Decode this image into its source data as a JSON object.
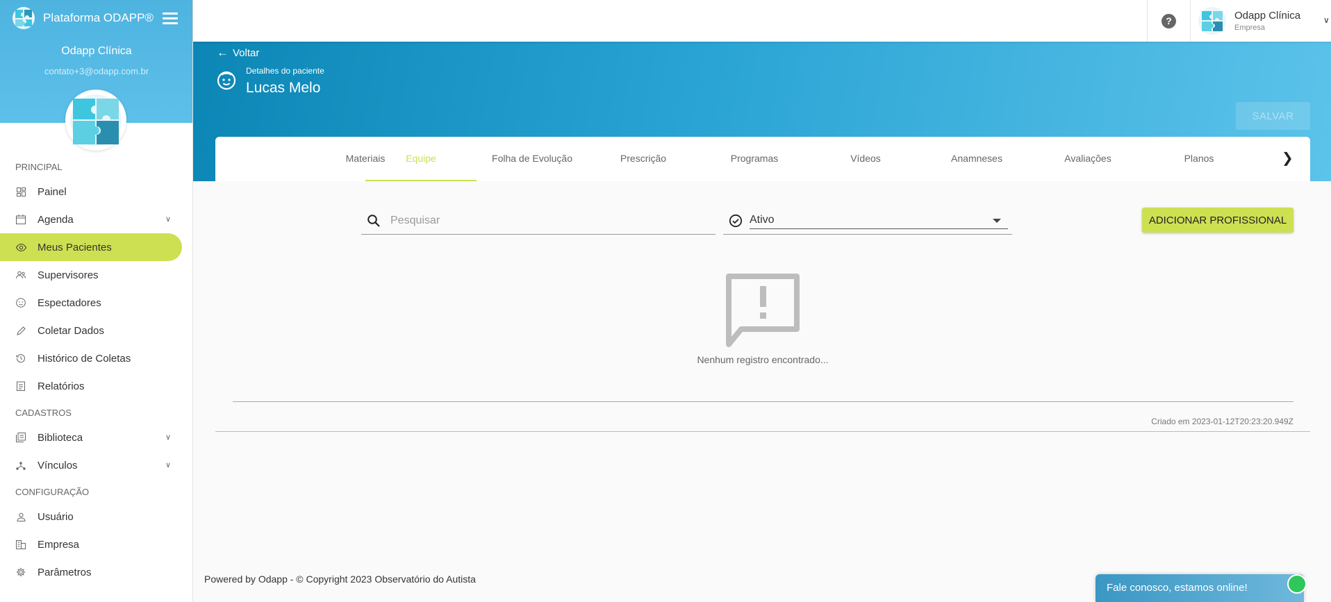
{
  "sidebar": {
    "brand": "Plataforma ODAPP®",
    "org_name": "Odapp Clínica",
    "email": "contato+3@odapp.com.br",
    "sections": {
      "principal": "PRINCIPAL",
      "cadastros": "CADASTROS",
      "configuracao": "CONFIGURAÇÃO"
    },
    "items": {
      "painel": "Painel",
      "agenda": "Agenda",
      "meus_pacientes": "Meus Pacientes",
      "supervisores": "Supervisores",
      "espectadores": "Espectadores",
      "coletar_dados": "Coletar Dados",
      "historico": "Histórico de Coletas",
      "relatorios": "Relatórios",
      "biblioteca": "Biblioteca",
      "vinculos": "Vínculos",
      "usuario": "Usuário",
      "empresa": "Empresa",
      "parametros": "Parâmetros"
    },
    "active_item": "Meus Pacientes"
  },
  "topbar": {
    "help_glyph": "?",
    "user_name": "Odapp Clínica",
    "user_role": "Empresa"
  },
  "header": {
    "back_label": "Voltar",
    "subtitle": "Detalhes do paciente",
    "patient_name": "Lucas Melo",
    "save_label": "SALVAR"
  },
  "tabs": {
    "items": [
      "Materiais",
      "Equipe",
      "Folha de Evolução",
      "Prescrição",
      "Programas",
      "Vídeos",
      "Anamneses",
      "Avaliações",
      "Planos"
    ],
    "active": "Equipe"
  },
  "filters": {
    "search_placeholder": "Pesquisar",
    "status_value": "Ativo",
    "add_label": "ADICIONAR PROFISSIONAL"
  },
  "empty_state": {
    "message": "Nenhum registro encontrado...",
    "icon": "feedback-alert-icon"
  },
  "meta": {
    "created": "Criado em 2023-01-12T20:23:20.949Z"
  },
  "footer": {
    "text": "Powered by Odapp - © Copyright 2023 Observatório do Autista"
  },
  "chat": {
    "label": "Fale conosco, estamos online!"
  },
  "colors": {
    "accent": "#cde052",
    "header_blue": "#1d96c8",
    "sidebar_blue": "#55b9e5",
    "online": "#2fc65b"
  }
}
